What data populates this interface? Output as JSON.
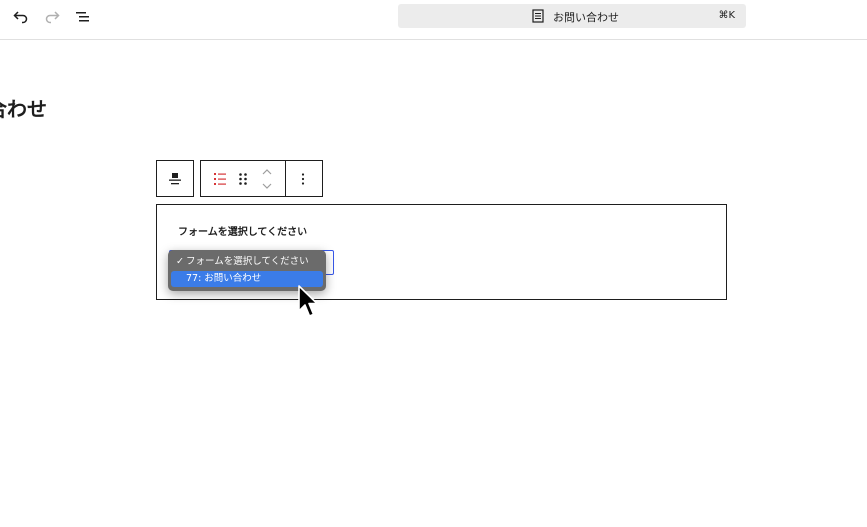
{
  "header": {
    "undo_icon": "undo-icon",
    "redo_icon": "redo-icon",
    "list_view_icon": "list-view-icon",
    "command_bar": {
      "icon": "page-icon",
      "title": "お問い合わせ",
      "shortcut": "⌘K"
    }
  },
  "page": {
    "title": "い合わせ"
  },
  "block_toolbar": {
    "align_icon": "align-icon",
    "block_type_icon": "form-list-icon",
    "drag_icon": "drag-handle-icon",
    "move_icon": "move-up-down-icon",
    "more_icon": "more-options-icon"
  },
  "form_block": {
    "label": "フォームを選択してください",
    "select": {
      "options": [
        {
          "label": "フォームを選択してください",
          "checked": true
        },
        {
          "label": "77: お問い合わせ",
          "highlighted": true
        }
      ]
    }
  },
  "colors": {
    "accent": "#3858e9",
    "highlight": "#3b7ce8",
    "menu_bg": "#6b6b6b",
    "list_icon": "#d63638"
  }
}
